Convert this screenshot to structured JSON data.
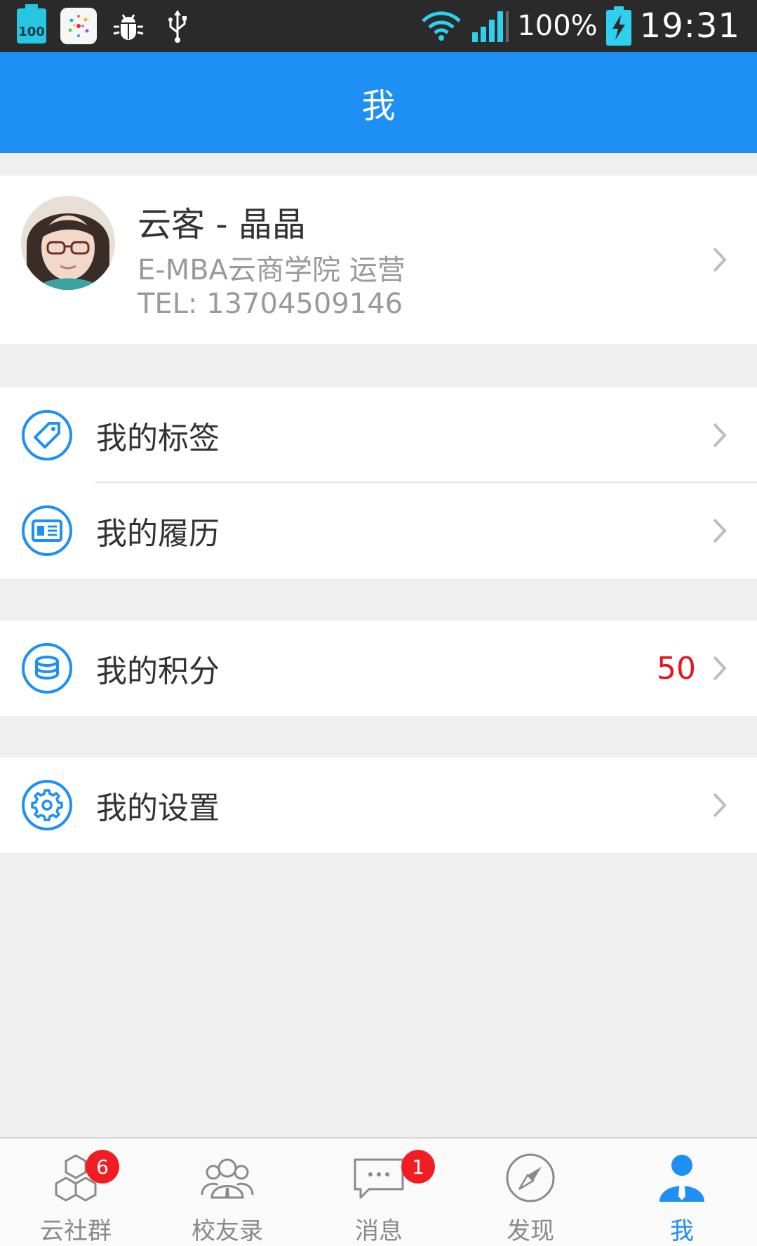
{
  "status_bar": {
    "battery_badge": "100",
    "battery_percent": "100%",
    "time": "19:31",
    "icons": [
      "battery-100-badge-icon",
      "app-icon",
      "debug-bug-icon",
      "usb-icon",
      "wifi-icon",
      "signal-icon",
      "battery-charging-icon"
    ]
  },
  "header": {
    "title": "我"
  },
  "profile": {
    "name": "云客 - 晶晶",
    "org": "E-MBA云商学院  运营",
    "tel": "TEL: 13704509146"
  },
  "menu": {
    "tags_label": "我的标签",
    "resume_label": "我的履历",
    "points_label": "我的积分",
    "points_value": "50",
    "settings_label": "我的设置"
  },
  "tabs": [
    {
      "label": "云社群",
      "badge": "6",
      "icon": "hexagon-cluster-icon"
    },
    {
      "label": "校友录",
      "icon": "alumni-people-icon"
    },
    {
      "label": "消息",
      "badge": "1",
      "icon": "chat-bubble-icon"
    },
    {
      "label": "发现",
      "icon": "compass-icon"
    },
    {
      "label": "我",
      "icon": "person-icon",
      "active": true
    }
  ],
  "colors": {
    "primary": "#1e8ff5",
    "badge": "#f21d22",
    "points": "#e8141e",
    "status_bar": "#2a2a2a",
    "background": "#efefef"
  }
}
